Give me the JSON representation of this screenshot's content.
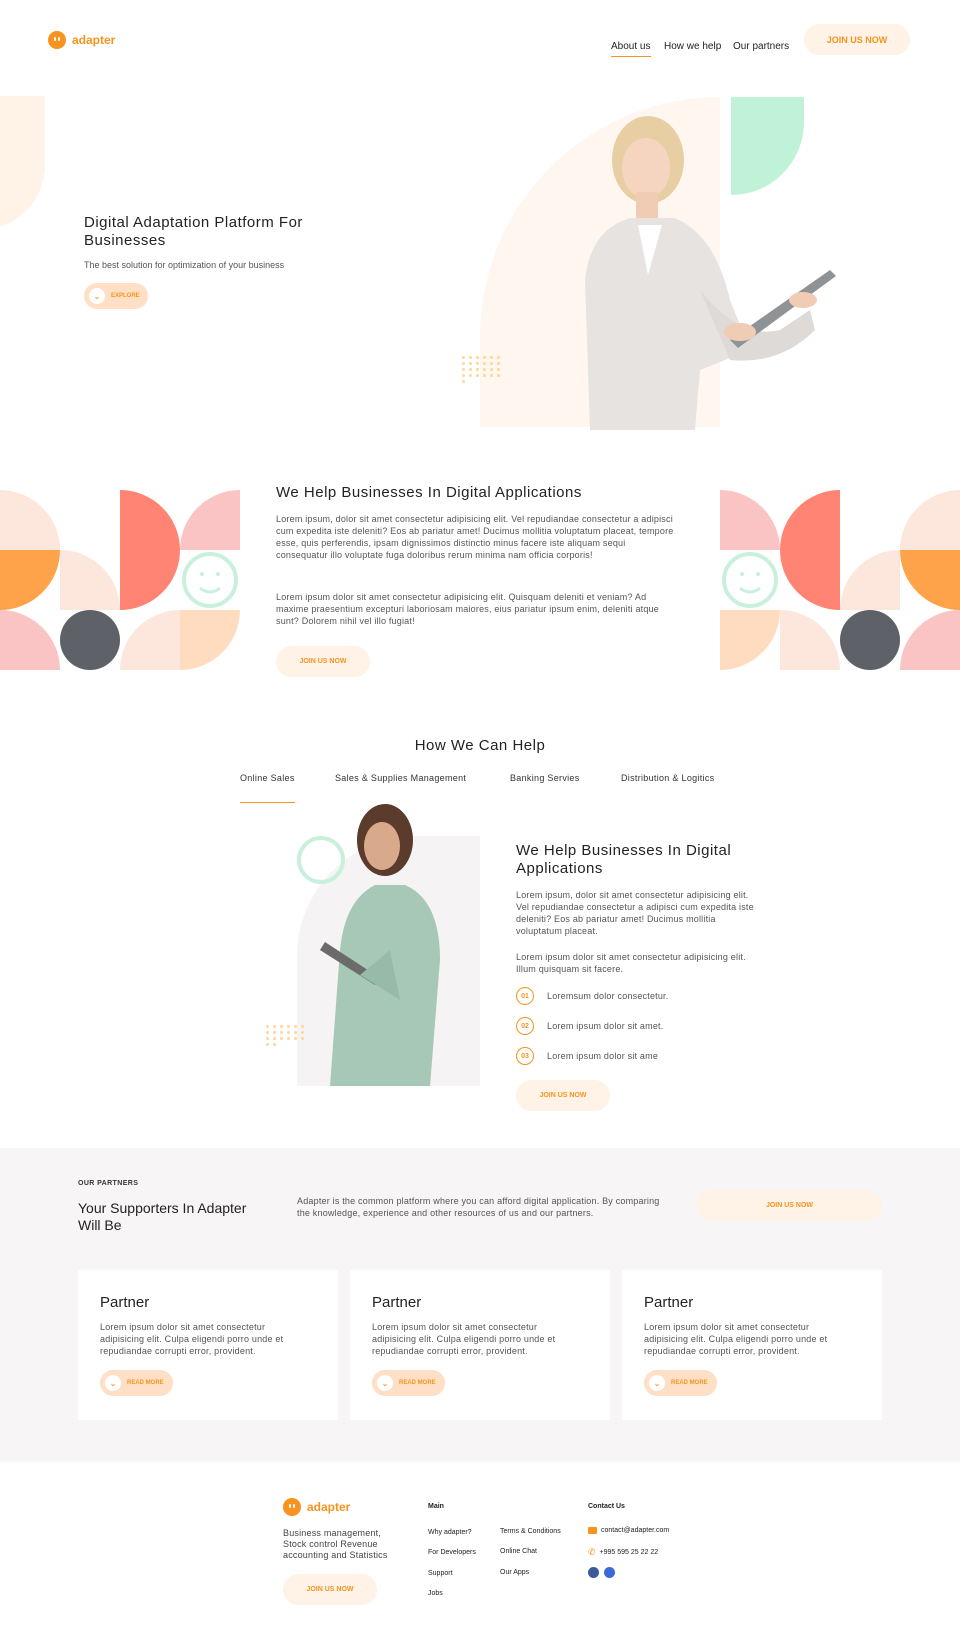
{
  "header": {
    "logo": "adapter",
    "nav": [
      "About us",
      "How we help",
      "Our partners"
    ],
    "cta": "JOIN US NOW"
  },
  "hero": {
    "title": "Digital Adaptation Platform For Businesses",
    "subtitle": "The best solution for optimization of your business",
    "button": "EXPLORE",
    "button_icon": "chevron-down-icon"
  },
  "help": {
    "title": "We Help Businesses In Digital Applications",
    "p1": "Lorem ipsum, dolor sit amet consectetur adipisicing elit. Vel repudiandae consectetur a adipisci cum expedita iste deleniti? Eos ab pariatur amet! Ducimus mollitia voluptatum placeat, tempore esse, quis perferendis, ipsam dignissimos distinctio minus facere iste aliquam sequi consequatur illo voluptate fuga doloribus rerum minima nam officia corporis!",
    "p2": "Lorem ipsum dolor sit amet consectetur adipisicing elit. Quisquam deleniti et veniam? Ad maxime praesentium excepturi laboriosam maiores, eius pariatur ipsum enim, deleniti atque sunt? Dolorem nihil vel illo fugiat!",
    "button": "JOIN US NOW"
  },
  "how": {
    "title": "How We Can Help",
    "tabs": [
      "Online Sales",
      "Sales & Supplies Management",
      "Banking Servies",
      "Distribution & Logitics"
    ],
    "active_tab": "Online Sales",
    "content_title": "We Help Businesses In Digital Applications",
    "p1": "Lorem ipsum, dolor sit amet consectetur adipisicing elit. Vel repudiandae consectetur a adipisci cum expedita iste deleniti? Eos ab pariatur amet! Ducimus mollitia voluptatum placeat.",
    "p2": "Lorem ipsum dolor sit amet consectetur adipisicing elit. Illum quisquam sit facere.",
    "list": [
      {
        "num": "01",
        "text": "Loremsum dolor consectetur."
      },
      {
        "num": "02",
        "text": "Lorem ipsum dolor sit amet."
      },
      {
        "num": "03",
        "text": "Lorem ipsum dolor sit ame"
      }
    ],
    "button": "JOIN US NOW"
  },
  "partners": {
    "eyebrow": "OUR PARTNERS",
    "title": "Your Supporters In Adapter Will Be",
    "description": "Adapter is the common platform where you can afford digital application. By comparing the knowledge, experience and other resources of us and our partners.",
    "button": "JOIN US NOW",
    "cards": [
      {
        "title": "Partner",
        "text": "Lorem ipsum dolor sit amet consectetur adipisicing elit. Culpa eligendi porro unde et repudiandae corrupti error, provident.",
        "button": "READ MORE"
      },
      {
        "title": "Partner",
        "text": "Lorem ipsum dolor sit amet consectetur adipisicing elit. Culpa eligendi porro unde et repudiandae corrupti error, provident.",
        "button": "READ MORE"
      },
      {
        "title": "Partner",
        "text": "Lorem ipsum dolor sit amet consectetur adipisicing elit. Culpa eligendi porro unde et repudiandae corrupti error, provident.",
        "button": "READ MORE"
      }
    ]
  },
  "footer": {
    "logo": "adapter",
    "tagline": "Business management, Stock control Revenue accounting and Statistics",
    "button": "JOIN US NOW",
    "main_heading": "Main",
    "main_col1": [
      "Why adapter?",
      "For Developers",
      "Support",
      "Jobs"
    ],
    "main_col2": [
      "Terms & Conditions",
      "Online Chat",
      "Our Apps"
    ],
    "contact_heading": "Contact Us",
    "email": "contact@adapter.com",
    "phone": "+995 595 25 22 22"
  },
  "colors": {
    "accent": "#f7931e",
    "peach": "#ffe0c7",
    "coral": "#ff8474",
    "pink": "#fbc4c4",
    "mint": "#bff2d6",
    "slate": "#5e6168",
    "footer_bg": "#f7f5f5"
  }
}
